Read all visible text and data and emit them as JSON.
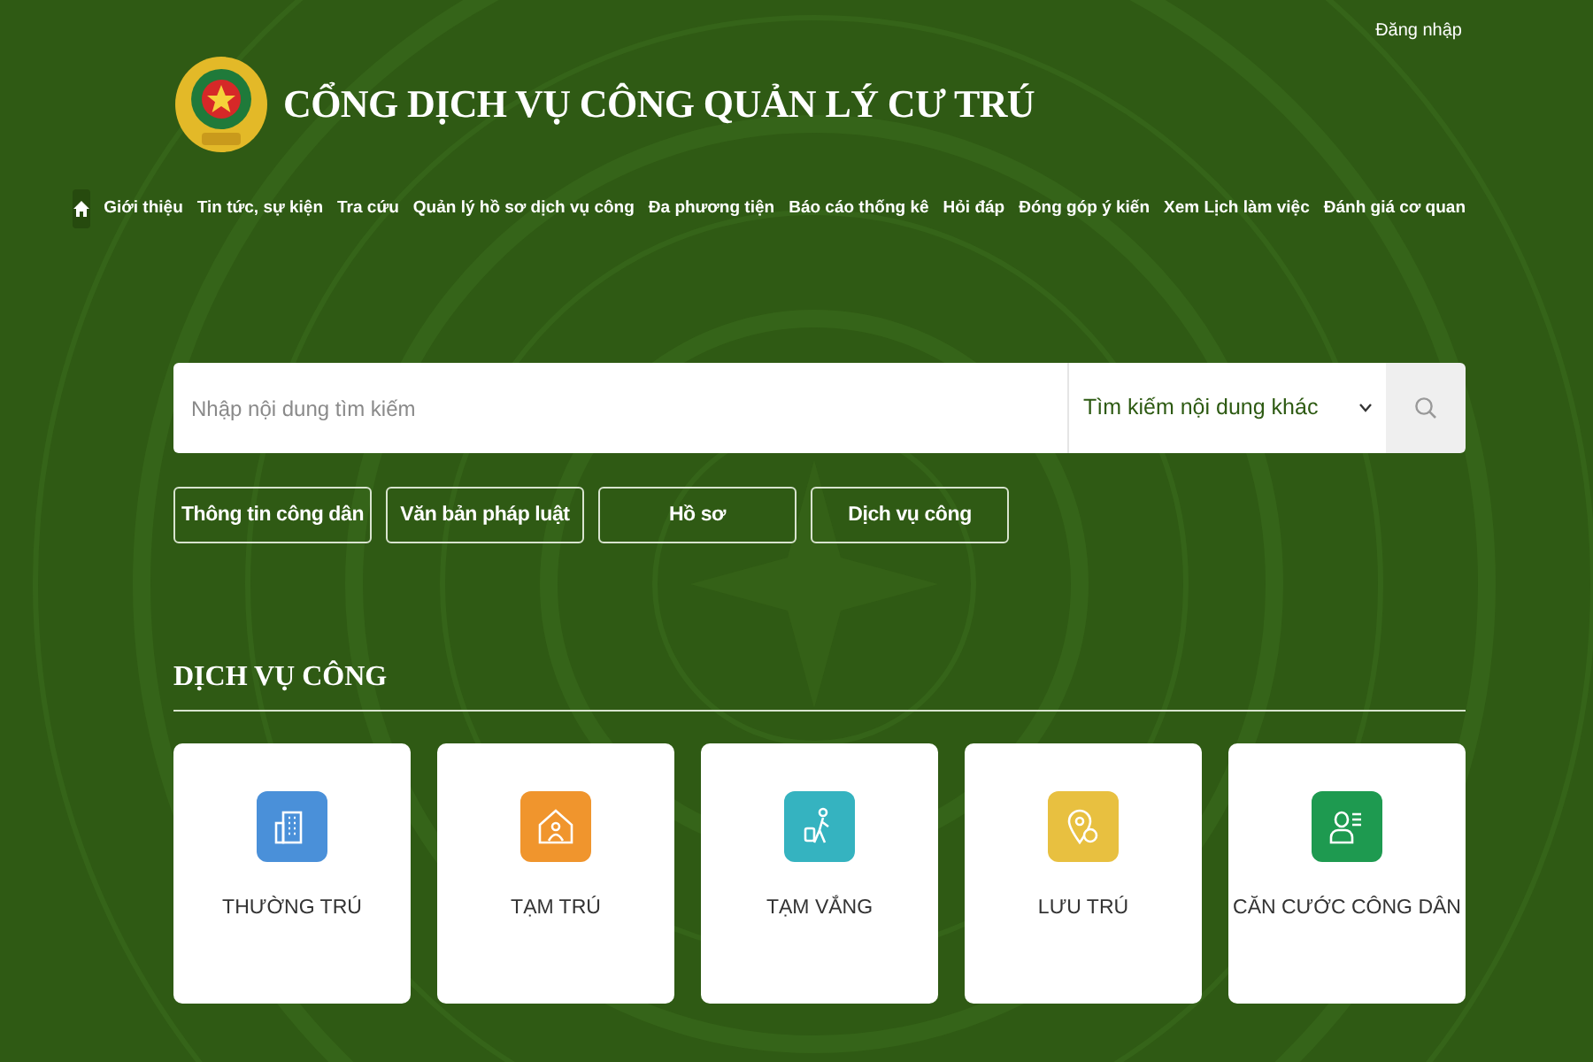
{
  "login": "Đăng nhập",
  "site_title": "CỔNG DỊCH VỤ CÔNG QUẢN LÝ CƯ TRÚ",
  "nav": {
    "home_selected": true,
    "items": [
      {
        "label": "Giới thiệu",
        "selected": false
      },
      {
        "label": "Tin tức, sự kiện",
        "selected": false
      },
      {
        "label": "Tra cứu",
        "selected": false
      },
      {
        "label": "Quản lý hồ sơ dịch vụ công",
        "selected": false
      },
      {
        "label": "Đa phương tiện",
        "selected": false
      },
      {
        "label": "Báo cáo thống kê",
        "selected": false
      },
      {
        "label": "Hỏi đáp",
        "selected": false
      },
      {
        "label": "Đóng góp ý kiến",
        "selected": false
      },
      {
        "label": "Xem Lịch làm việc",
        "selected": false
      },
      {
        "label": "Đánh giá cơ quan",
        "selected": false
      }
    ]
  },
  "search": {
    "placeholder": "Nhập nội dung tìm kiếm",
    "scope": "Tìm kiếm nội dung khác"
  },
  "quick_buttons": [
    "Thông tin công dân",
    "Văn bản pháp luật",
    "Hồ sơ",
    "Dịch vụ công"
  ],
  "section_title": "DỊCH VỤ CÔNG",
  "services": [
    {
      "label": "THƯỜNG TRÚ",
      "kind": "building",
      "color": "#4a90d9"
    },
    {
      "label": "TẠM TRÚ",
      "kind": "house",
      "color": "#f0952d"
    },
    {
      "label": "TẠM VẮNG",
      "kind": "traveler",
      "color": "#35b3c0"
    },
    {
      "label": "LƯU TRÚ",
      "kind": "pin",
      "color": "#e8c040"
    },
    {
      "label": "CĂN CƯỚC CÔNG DÂN",
      "kind": "idcard",
      "color": "#1e9a50"
    }
  ]
}
